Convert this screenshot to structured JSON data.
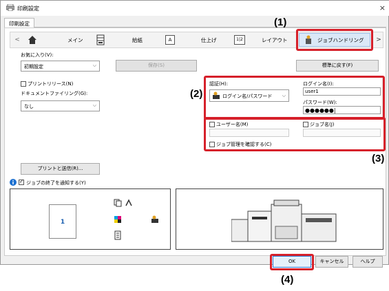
{
  "window": {
    "title": "印刷設定",
    "close": "×"
  },
  "tab": {
    "label": "印刷設定"
  },
  "ribbon": {
    "items": [
      {
        "label": "メイン",
        "icon": "home-icon"
      },
      {
        "label": "給紙",
        "icon": "paper-tray-icon"
      },
      {
        "label": "仕上げ",
        "icon": "A-page-icon"
      },
      {
        "label": "レイアウト",
        "icon": "layout-icon"
      },
      {
        "label": "ジョブハンドリング",
        "icon": "job-handling-icon"
      }
    ],
    "prev": "<",
    "next": ">"
  },
  "favorites": {
    "label": "お気に入り(V):",
    "value": "初期設定",
    "save_button": "保存(S)",
    "default_button": "標準に戻す(F)"
  },
  "left": {
    "print_release_label": "プリントリリース(N)",
    "doc_filing_label": "ドキュメントファイリング(G):",
    "doc_filing_value": "なし",
    "print_send_button": "プリントと送信(R)...",
    "notify_label": "ジョブの終了を通知する(Y)"
  },
  "auth": {
    "label": "認証(H):",
    "value": "ログイン名/パスワード",
    "login_label": "ログイン名(I):",
    "login_value": "user1",
    "password_label": "パスワード(W):",
    "password_value": "●●●●●●|"
  },
  "job": {
    "username_label": "ユーザー名(M)",
    "jobname_label": "ジョブ名(J)",
    "confirm_label": "ジョブ管理を確認する(C)"
  },
  "preview": {
    "page_number": "1"
  },
  "footer": {
    "ok": "OK",
    "cancel": "キャンセル",
    "help": "ヘルプ"
  },
  "callouts": {
    "c1": "(1)",
    "c2": "(2)",
    "c3": "(3)",
    "c4": "(4)"
  },
  "colors": {
    "accent_red": "#d6202a",
    "ok_border": "#2a7ad6"
  }
}
